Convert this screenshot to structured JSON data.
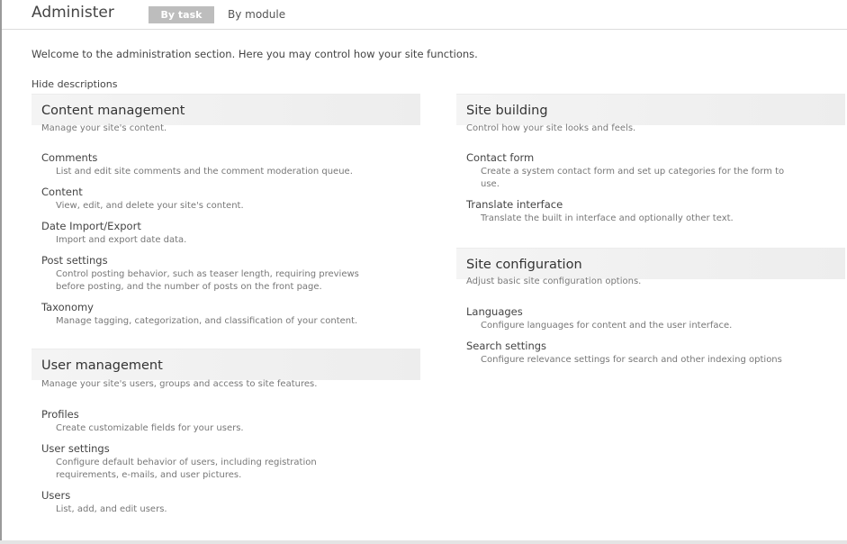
{
  "header": {
    "title": "Administer",
    "tabs": [
      {
        "label": "By task",
        "active": true
      },
      {
        "label": "By module",
        "active": false
      }
    ]
  },
  "welcome": "Welcome to the administration section. Here you may control how your site functions.",
  "hide_descriptions": "Hide descriptions",
  "panels": {
    "content": {
      "title": "Content management",
      "desc": "Manage your site's content.",
      "items": [
        {
          "title": "Comments",
          "desc": "List and edit site comments and the comment moderation queue."
        },
        {
          "title": "Content",
          "desc": "View, edit, and delete your site's content."
        },
        {
          "title": "Date Import/Export",
          "desc": "Import and export date data."
        },
        {
          "title": "Post settings",
          "desc_1": "Control posting behavior, such as teaser length, requiring previews",
          "desc_2": "before posting, and the number of posts on the front page."
        },
        {
          "title": "Taxonomy",
          "desc": "Manage tagging, categorization, and classification of your content."
        }
      ]
    },
    "users": {
      "title": "User management",
      "desc": "Manage your site's users, groups and access to site features.",
      "items": [
        {
          "title": "Profiles",
          "desc": "Create customizable fields for your users."
        },
        {
          "title": "User settings",
          "desc_1": "Configure default behavior of users, including registration",
          "desc_2": "requirements, e-mails, and user pictures."
        },
        {
          "title": "Users",
          "desc": "List, add, and edit users."
        }
      ]
    },
    "building": {
      "title": "Site building",
      "desc": "Control how your site looks and feels.",
      "items": [
        {
          "title": "Contact form",
          "desc_1": "Create a system contact form and set up categories for the form to",
          "desc_2": "use."
        },
        {
          "title": "Translate interface",
          "desc": "Translate the built in interface and optionally other text."
        }
      ]
    },
    "config": {
      "title": "Site configuration",
      "desc": "Adjust basic site configuration options.",
      "items": [
        {
          "title": "Languages",
          "desc": "Configure languages for content and the user interface."
        },
        {
          "title": "Search settings",
          "desc": "Configure relevance settings for search and other indexing options"
        }
      ]
    }
  }
}
